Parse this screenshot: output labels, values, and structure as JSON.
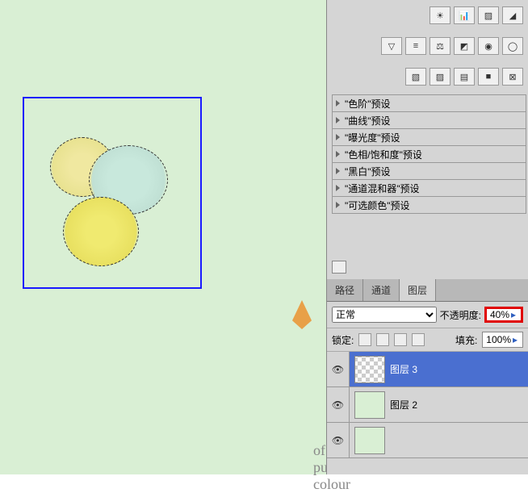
{
  "presets": [
    "\"色阶\"预设",
    "\"曲线\"预设",
    "\"曝光度\"预设",
    "\"色相/饱和度\"预设",
    "\"黑白\"预设",
    "\"通道混和器\"预设",
    "\"可选颜色\"预设"
  ],
  "tabs": {
    "path": "路径",
    "channel": "通道",
    "layer": "图层"
  },
  "blend": {
    "mode": "正常",
    "opacity_lbl": "不透明度:",
    "opacity": "40%",
    "lock_lbl": "锁定:",
    "fill_lbl": "填充:",
    "fill": "100%"
  },
  "layers": {
    "l3": "图层 3",
    "l2": "图层 2"
  },
  "watermark": "of pure colour",
  "icons": {
    "r1": [
      "☀",
      "📊",
      "▨",
      "◢"
    ],
    "r2": [
      "▽",
      "≡",
      "⚖",
      "◩",
      "◉",
      "◯"
    ],
    "r3": [
      "▧",
      "▨",
      "▤",
      "■",
      "⊠"
    ]
  }
}
